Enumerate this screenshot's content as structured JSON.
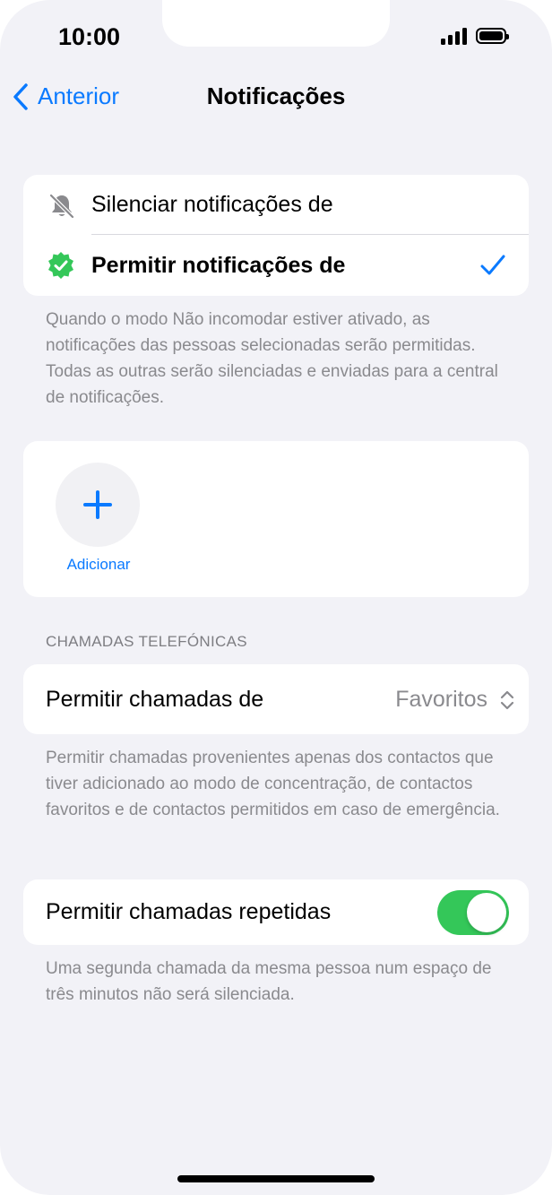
{
  "status_bar": {
    "time": "10:00"
  },
  "nav": {
    "back_label": "Anterior",
    "title": "Notificações"
  },
  "notification_mode": {
    "options": [
      {
        "label": "Silenciar notificações de",
        "icon": "bell-slash-icon",
        "selected": false
      },
      {
        "label": "Permitir notificações de",
        "icon": "checkmark-seal-icon",
        "selected": true
      }
    ],
    "footnote": "Quando o modo Não incomodar estiver ativado, as notificações das pessoas selecionadas serão permitidas. Todas as outras serão silenciadas e enviadas para a central de notificações."
  },
  "people": {
    "add_label": "Adicionar"
  },
  "calls": {
    "section_header": "CHAMADAS TELEFÓNICAS",
    "allow_calls_label": "Permitir chamadas de",
    "allow_calls_value": "Favoritos",
    "allow_calls_footnote": "Permitir chamadas provenientes apenas dos contactos que tiver adicionado ao modo de concentração, de contactos favoritos e de contactos permitidos em caso de emergência.",
    "repeated_calls_label": "Permitir chamadas repetidas",
    "repeated_calls_on": true,
    "repeated_calls_footnote": "Uma segunda chamada da mesma pessoa num espaço de três minutos não será silenciada."
  },
  "colors": {
    "accent": "#0a7aff",
    "toggle_on": "#34c759",
    "seal_green": "#34c759",
    "background": "#f2f2f7"
  }
}
